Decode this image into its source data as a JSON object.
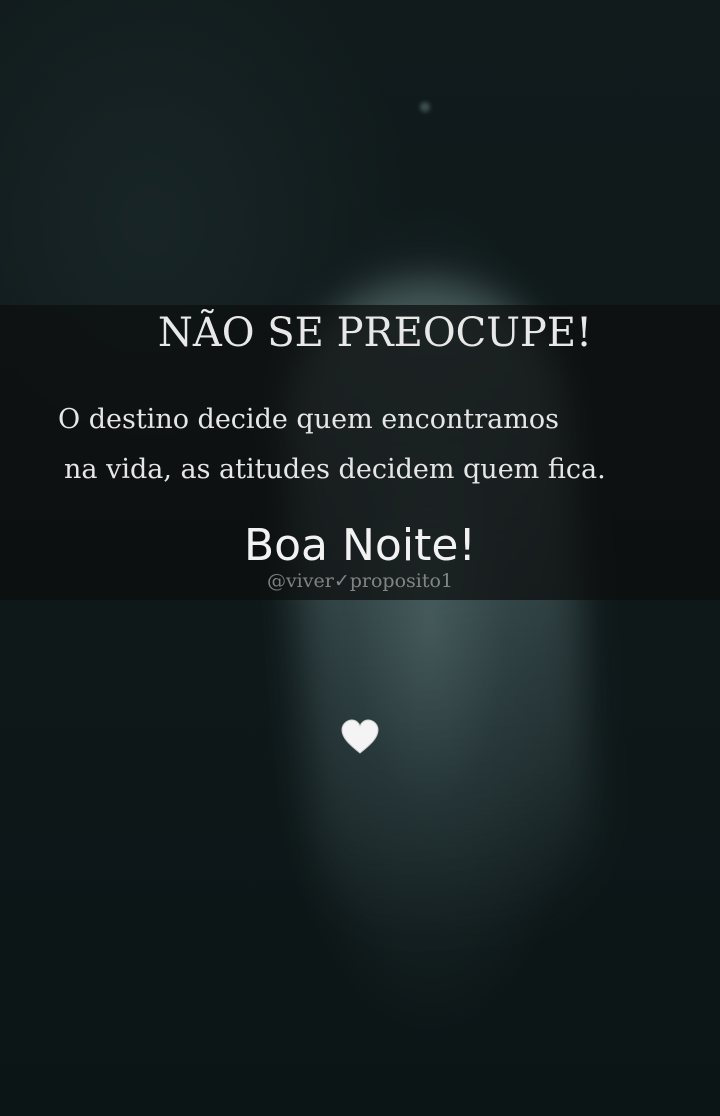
{
  "post": {
    "headline": "NÃO SE PREOCUPE!",
    "body_line_1": "O destino decide quem encontramos",
    "body_line_2": "na vida, as atitudes decidem quem fica.",
    "greeting": "Boa Noite!",
    "watermark": "@viver✓proposito1",
    "heart_icon": "white-heart-icon"
  },
  "colors": {
    "text": "#e8e8e8",
    "banner": "#0c0e0e",
    "background": "#0e1819"
  }
}
